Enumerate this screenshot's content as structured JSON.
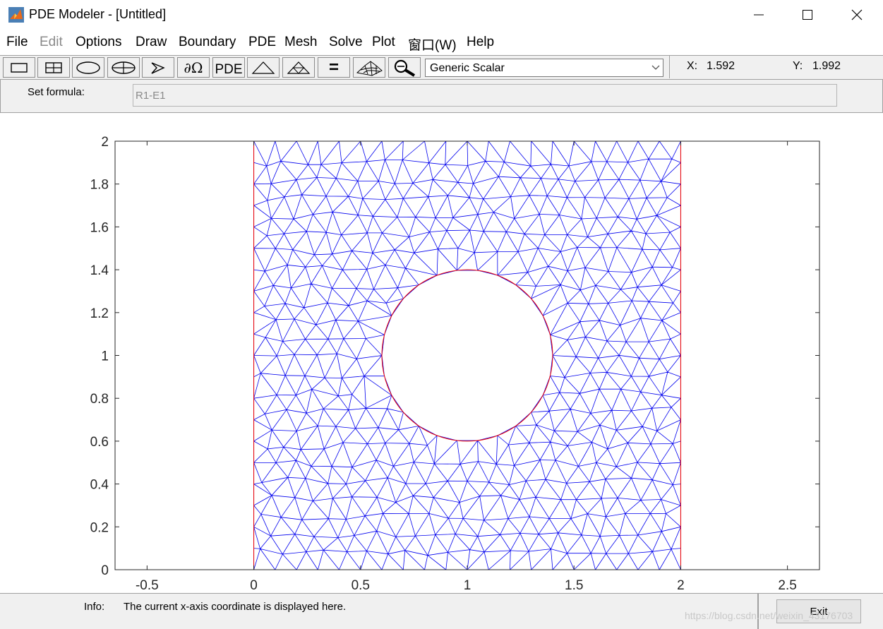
{
  "window": {
    "title": "PDE Modeler - [Untitled]",
    "minimize_symbol": "—",
    "maximize_symbol": "☐",
    "close_symbol": "✕"
  },
  "menu": [
    {
      "label": "File",
      "enabled": true
    },
    {
      "label": "Edit",
      "enabled": false
    },
    {
      "label": "Options",
      "enabled": true
    },
    {
      "label": "Draw",
      "enabled": true
    },
    {
      "label": "Boundary",
      "enabled": true
    },
    {
      "label": "PDE",
      "enabled": true
    },
    {
      "label": "Mesh",
      "enabled": true
    },
    {
      "label": "Solve",
      "enabled": true
    },
    {
      "label": "Plot",
      "enabled": true
    },
    {
      "label": "窗口(W)",
      "enabled": true
    },
    {
      "label": "Help",
      "enabled": true
    }
  ],
  "toolbar": {
    "buttons": [
      {
        "icon": "rectangle-icon"
      },
      {
        "icon": "rectangle-center-icon"
      },
      {
        "icon": "ellipse-icon"
      },
      {
        "icon": "ellipse-center-icon"
      },
      {
        "icon": "polygon-icon"
      },
      {
        "icon": "boundary-mode-icon",
        "label": "∂Ω"
      },
      {
        "icon": "pde-spec-icon",
        "label": "PDE"
      },
      {
        "icon": "init-mesh-icon"
      },
      {
        "icon": "refine-mesh-icon"
      },
      {
        "icon": "solve-icon",
        "label": "="
      },
      {
        "icon": "plot-3d-icon"
      },
      {
        "icon": "zoom-icon"
      }
    ],
    "application_mode": "Generic Scalar",
    "x_label": "X:",
    "x_value": "1.592",
    "y_label": "Y:",
    "y_value": "1.992"
  },
  "formula": {
    "label": "Set formula:",
    "value": "R1-E1"
  },
  "chart_data": {
    "type": "scatter",
    "description_of_content": "triangular mesh",
    "geometry": {
      "rectangle": {
        "x": [
          0,
          2
        ],
        "y": [
          0,
          2
        ]
      },
      "circle_hole": {
        "center": [
          1,
          1
        ],
        "radius": 0.4
      }
    },
    "xlim": [
      -0.65,
      2.65
    ],
    "ylim": [
      0,
      2
    ],
    "xticks": [
      "-0.5",
      "0",
      "0.5",
      "1",
      "1.5",
      "2",
      "2.5"
    ],
    "xtick_values": [
      -0.5,
      0,
      0.5,
      1,
      1.5,
      2,
      2.5
    ],
    "yticks": [
      "0",
      "0.2",
      "0.4",
      "0.6",
      "0.8",
      "1",
      "1.2",
      "1.4",
      "1.6",
      "1.8",
      "2"
    ],
    "ytick_values": [
      0,
      0.2,
      0.4,
      0.6,
      0.8,
      1,
      1.2,
      1.4,
      1.6,
      1.8,
      2
    ],
    "mesh_color": "#0000ee",
    "boundary_color": "#ee0000",
    "grid": false
  },
  "status": {
    "info_label": "Info:",
    "info_text": "The current x-axis coordinate is displayed here.",
    "exit_label": "Exit",
    "watermark": "https://blog.csdn.net/weixin_43176703"
  }
}
